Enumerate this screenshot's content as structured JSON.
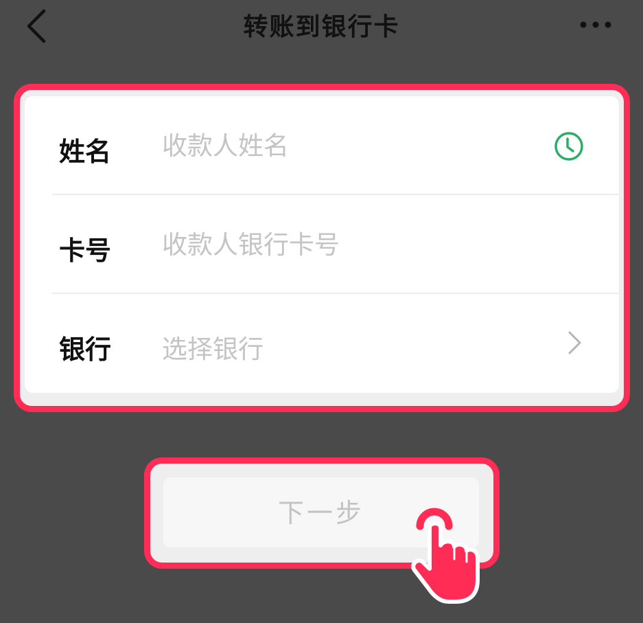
{
  "header": {
    "back_icon": "chevron-left-icon",
    "title": "转账到银行卡",
    "more_icon": "more-dots-icon"
  },
  "form": {
    "name": {
      "label": "姓名",
      "placeholder": "收款人姓名",
      "value": "",
      "icon": "clock-history-icon",
      "icon_color": "#2aae67"
    },
    "card": {
      "label": "卡号",
      "placeholder": "收款人银行卡号",
      "value": ""
    },
    "bank": {
      "label": "银行",
      "value": "选择银行",
      "icon": "chevron-right-icon"
    }
  },
  "next_button": {
    "label": "下一步"
  },
  "annotation": {
    "highlight_color": "#ff2c55",
    "pointer_icon": "hand-pointer-icon"
  }
}
